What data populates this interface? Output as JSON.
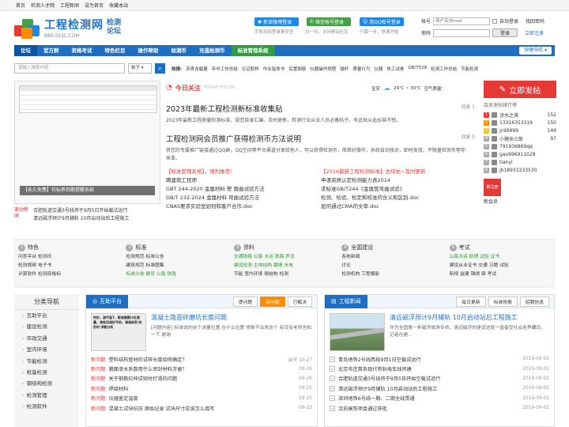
{
  "topbar": [
    "首页",
    "检测人才网",
    "工程新闻",
    "设为首页",
    "收藏本站"
  ],
  "logo": {
    "main": "工程检测网",
    "side1": "检测",
    "side2": "论坛",
    "sub": "BBS.GCJC.COM"
  },
  "header": {
    "weibo_btn": "新浪微博登录",
    "weibo_sub": "手机扫码登录更安全",
    "wechat_btn": "微信帐号登录",
    "wechat_sub": "扫一扫，访问移动社区",
    "qq_btn": "用QQ帐号登录",
    "qq_sub": "只需一步，快速开始"
  },
  "login": {
    "account_label": "帐号",
    "account_placeholder": "用户名/Email",
    "auto_login": "自动登录",
    "find_pwd": "找回密码",
    "password_label": "密码",
    "login_btn": "登录",
    "register": "立即注册"
  },
  "nav": {
    "items": [
      "论坛",
      "官方群",
      "资格考试",
      "特色栏目",
      "操作帮助",
      "检测币",
      "充值检测币",
      "标准管理系统"
    ],
    "quick": "快捷导航"
  },
  "search": {
    "placeholder": "请输入搜索内容",
    "select": "帖子",
    "hot_label": "热搜:",
    "hot": [
      "沥青含蜡量",
      "年中工作总结",
      "见证取样",
      "作业指导书",
      "后置钢筋",
      "仪器操作规程",
      "锚杆",
      "质量行为",
      "仪器",
      "热工试卷",
      "GB/T528",
      "检测工作总结",
      "节能检测",
      "检测报告记录表",
      "危险化学品"
    ]
  },
  "slide": {
    "caption": "【永久免费】社标养到期提醒系统"
  },
  "roll": {
    "label": "滚动新闻",
    "items": [
      "合肥轨道交通3号线将于9月5日开始载试运行",
      "清远磁浮预计9月辅轨 10月启动站后工程施工"
    ]
  },
  "today": {
    "mark": "今日关注",
    "mark_en": "TODAY FOCUS",
    "weather_city": "宝安",
    "weather_temp": "24℃ ~ 30℃",
    "weather_aqi": "空气质量：",
    "art1_title": "2023年最新工程检测新标准收集贴",
    "art1_desc": "2023年最新工程质量检测标准，规范目录汇编，及时更新，检测行业从业人员必备帖子，有此贴从此标准不愁。",
    "art1_reply": "回复 1",
    "art2_title": "工程检测网会员推广获得检测币方法说明",
    "art2_desc": "将您的专属推广链接通过QQ群，QQ空间等平台渠道分享给他人，可以获得检测币，简单好操作，系统自动核对，即时发放。不限量检测币等你来拿。",
    "art2_reply": "回复 0",
    "col1": [
      "【标准管理系统】，强烈推荐！",
      "聘建筑工程师",
      "GBT 244-2020 金属材料 警 裔曲试验方法",
      "GB/T 232-2024 金属材料 弯曲试验方法",
      "CNAS要求实验室如何和客户合作.doc"
    ],
    "col2": [
      "【2016最新工程检测标准】总结帖~及时更新",
      "申请资质认定检测能力表2014",
      "求标准GB/T244《金属管弯曲试验》",
      "检测、检验、检定和校准的含义和区别.doc",
      "如何通过CMA的文审.doc"
    ]
  },
  "side": {
    "post": "立即发帖",
    "rank_title": "会员发帖排行榜",
    "rank": [
      "汶水之滨",
      "13316353319",
      "jc99999",
      "小猪命三郎",
      "791936869qq",
      "gao996911028",
      "tianyi",
      "jb18933233530"
    ],
    "rank_vals": [
      "152",
      "150",
      "149",
      "97",
      "",
      "",
      "",
      ""
    ],
    "new_user": "新注册",
    "new_user_label": "新会员"
  },
  "cats": [
    {
      "num": "1",
      "title": "特色",
      "lines": [
        "问答平台 检测币",
        "检测视频 电子书",
        "计算软件 检测资格标"
      ]
    },
    {
      "num": "2",
      "title": "标准",
      "lines": [
        "检测规范 标准公告",
        "建筑规范 标准图集",
        "标准分类 建设 公路 铁路"
      ]
    },
    {
      "num": "3",
      "title": "资料",
      "lines": [
        "交通铁路 公路 水运 铁路 养设",
        "建设检测 主体结构 幕墙 水电",
        "节能 室内环境 钢结构 检测"
      ]
    },
    {
      "num": "4",
      "title": "全国建设",
      "lines": [
        "各地新闻",
        "讨论",
        "检测机构 工程摄影"
      ]
    },
    {
      "num": "5",
      "title": "考试",
      "lines": [
        "公路水运 助理 试验 证书",
        "建设从业证书 交通 习题 试验",
        "新规 益建 锦绣 锦 考试"
      ]
    }
  ],
  "catnav": {
    "title": "分类导航",
    "items": [
      "互助平台",
      "建设检测",
      "市政交通",
      "室内环境",
      "节能检测",
      "桩基检测",
      "钢结构检测",
      "检测管理",
      "检测软件"
    ]
  },
  "qa": {
    "label": "互助平台",
    "tabs": [
      "提问题",
      "新问题",
      "已解决"
    ],
    "feature_title": "混凝土路面砖磨坑长度问题",
    "feature_desc": "[问题内容] 标准说的这个测量位置 在什么位置 想象不出来这个 有没有老师告知一下 谢谢",
    "img_text": "你好，测平面7，都准确要计位测量，请各后相好平的，请测体积 的形材 求教分析",
    "items": [
      {
        "k": "新问题",
        "t": "塑料结构管材的试样长度如何确定？",
        "d": "前天 10:27"
      },
      {
        "k": "新问题",
        "t": "路面渗水系数用什么密封材料方便？",
        "d": "09-26"
      },
      {
        "k": "新问题",
        "t": "关于钢筋拉伸试验时打滑的问题",
        "d": "09-26"
      },
      {
        "k": "新问题",
        "t": "焊接材料",
        "d": "09-25"
      },
      {
        "k": "新问题",
        "t": "仪器鉴定温度",
        "d": "09-25"
      },
      {
        "k": "新问题",
        "t": "混凝土试块抗压 原始记录 试块尺寸应该怎么填写",
        "d": "09-23"
      }
    ]
  },
  "news": {
    "label": "工程新闻",
    "tabs": [
      "每日更新",
      "标准快报",
      "招聘信息"
    ],
    "feature_title": "清远磁浮预计9月辅轨 10月启动站后工程施工",
    "feature_desc": "作为全国第一条磁浮旅游专线，清远磁浮的建设进度一直备受社会各界瞩目，记者在建...",
    "items": [
      {
        "t": "青岛地铁2号线西段9月1日空载试运行",
        "d": "2019-09-02"
      },
      {
        "t": "北京市庄首条现代有轨电车线将建",
        "d": "2019-09-02"
      },
      {
        "t": "合肥轨道交通3号线将于9月5日开始空载试运行",
        "d": "2019-09-02"
      },
      {
        "t": "清远磁浮预计9月辅轨 10月启动站后工程施工",
        "d": "2019-09-02"
      },
      {
        "t": "深圳地铁6号线一期、二期全线贯通",
        "d": "2019-09-02"
      },
      {
        "t": "沈白高铁项目通过获批",
        "d": "2019-09-02"
      }
    ]
  }
}
